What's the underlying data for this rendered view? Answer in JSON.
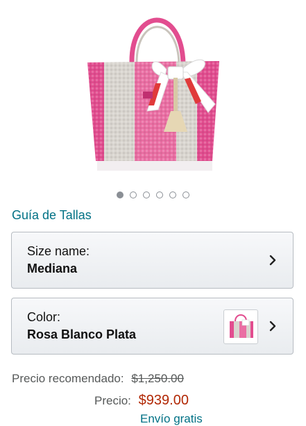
{
  "product": {
    "image_name": "woven-tote-bag"
  },
  "carousel": {
    "total": 6,
    "active_index": 0
  },
  "size_guide": {
    "label": "Guía de Tallas"
  },
  "size_selector": {
    "label": "Size name:",
    "value": "Mediana"
  },
  "color_selector": {
    "label": "Color:",
    "value": "Rosa Blanco Plata"
  },
  "pricing": {
    "list_label": "Precio recomendado:",
    "list_price": "$1,250.00",
    "price_label": "Precio:",
    "price": "$939.00",
    "shipping": "Envío gratis"
  },
  "colors": {
    "link": "#007185",
    "price": "#b12704",
    "pink": "#e24d8f",
    "silver": "#d9d5cf"
  }
}
